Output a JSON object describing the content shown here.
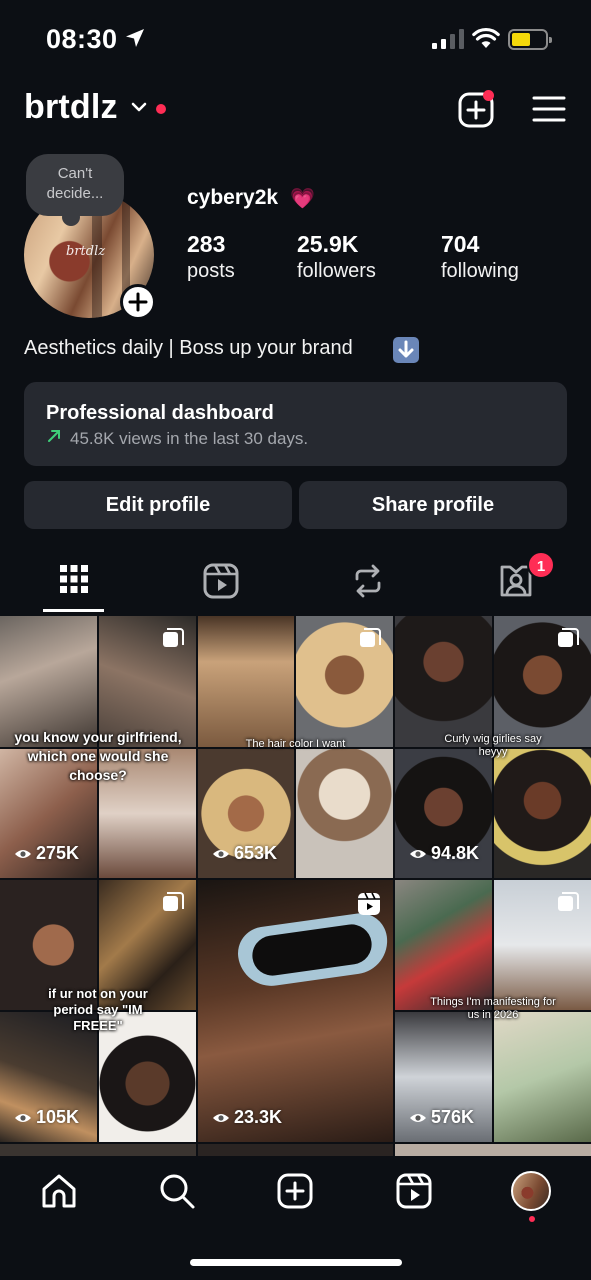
{
  "status_bar": {
    "time": "08:30",
    "icons": [
      "location-arrow-icon",
      "signal-icon",
      "wifi-icon",
      "battery-icon"
    ],
    "battery_color": "#f5d90a"
  },
  "header": {
    "username": "brtdlz",
    "icons": [
      "chevron-down-icon",
      "create-icon",
      "menu-icon"
    ],
    "notification_color": "#ff2d55"
  },
  "profile": {
    "note": [
      "Can't",
      "decide..."
    ],
    "display_name": "cybery2k",
    "display_emoji": "💗",
    "stats": [
      {
        "value": "283",
        "label": "posts"
      },
      {
        "value": "25.9K",
        "label": "followers"
      },
      {
        "value": "704",
        "label": "following"
      }
    ],
    "bio": "Aesthetics daily | Boss up your brand",
    "bio_emoji": "⬇️"
  },
  "dashboard": {
    "title": "Professional dashboard",
    "subtitle": "45.8K views in the last 30 days.",
    "trend_color": "#3fd07a"
  },
  "actions": {
    "edit": "Edit profile",
    "share": "Share profile"
  },
  "tabs": {
    "items": [
      "grid-icon",
      "reels-icon",
      "reposts-icon",
      "tagged-icon"
    ],
    "tagged_badge": "1"
  },
  "grid": [
    {
      "caption": "you know your girlfriend, which one would she choose?",
      "views": "275K",
      "icon": "carousel-icon"
    },
    {
      "caption": "The hair color I want",
      "views": "653K",
      "icon": "carousel-icon"
    },
    {
      "caption": "Curly wig girlies say heyyy",
      "views": "94.8K",
      "icon": "carousel-icon"
    },
    {
      "caption": "if ur not on your period say \"IM FREEE\"",
      "views": "105K",
      "icon": "carousel-icon"
    },
    {
      "caption": "",
      "views": "23.3K",
      "icon": "reels-icon"
    },
    {
      "caption": "Things I'm manifesting for us in 2026",
      "views": "576K",
      "icon": "carousel-icon"
    }
  ],
  "bottom_nav": {
    "items": [
      "home-icon",
      "search-icon",
      "create-icon",
      "reels-icon",
      "profile-avatar"
    ]
  }
}
